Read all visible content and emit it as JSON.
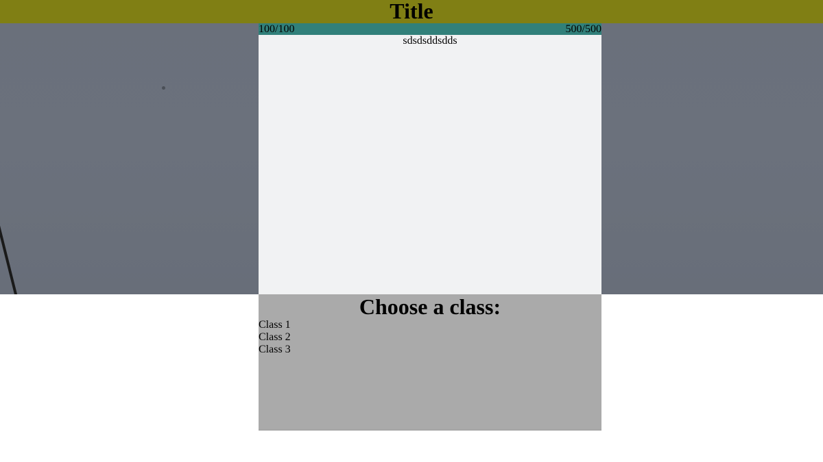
{
  "header": {
    "title": "Title"
  },
  "stats": {
    "left_value": "100/100",
    "right_value": "500/500"
  },
  "panel": {
    "message": "sdsdsddsdds"
  },
  "chooser": {
    "heading": "Choose a class:",
    "options": [
      {
        "label": "Class 1"
      },
      {
        "label": "Class 2"
      },
      {
        "label": "Class 3"
      }
    ]
  },
  "colors": {
    "header_bg": "#807f14",
    "stats_bg": "#31807a",
    "panel_bg": "#f1f2f3",
    "chooser_bg": "#aaaaaa",
    "scene_bg": "#6a707b"
  }
}
